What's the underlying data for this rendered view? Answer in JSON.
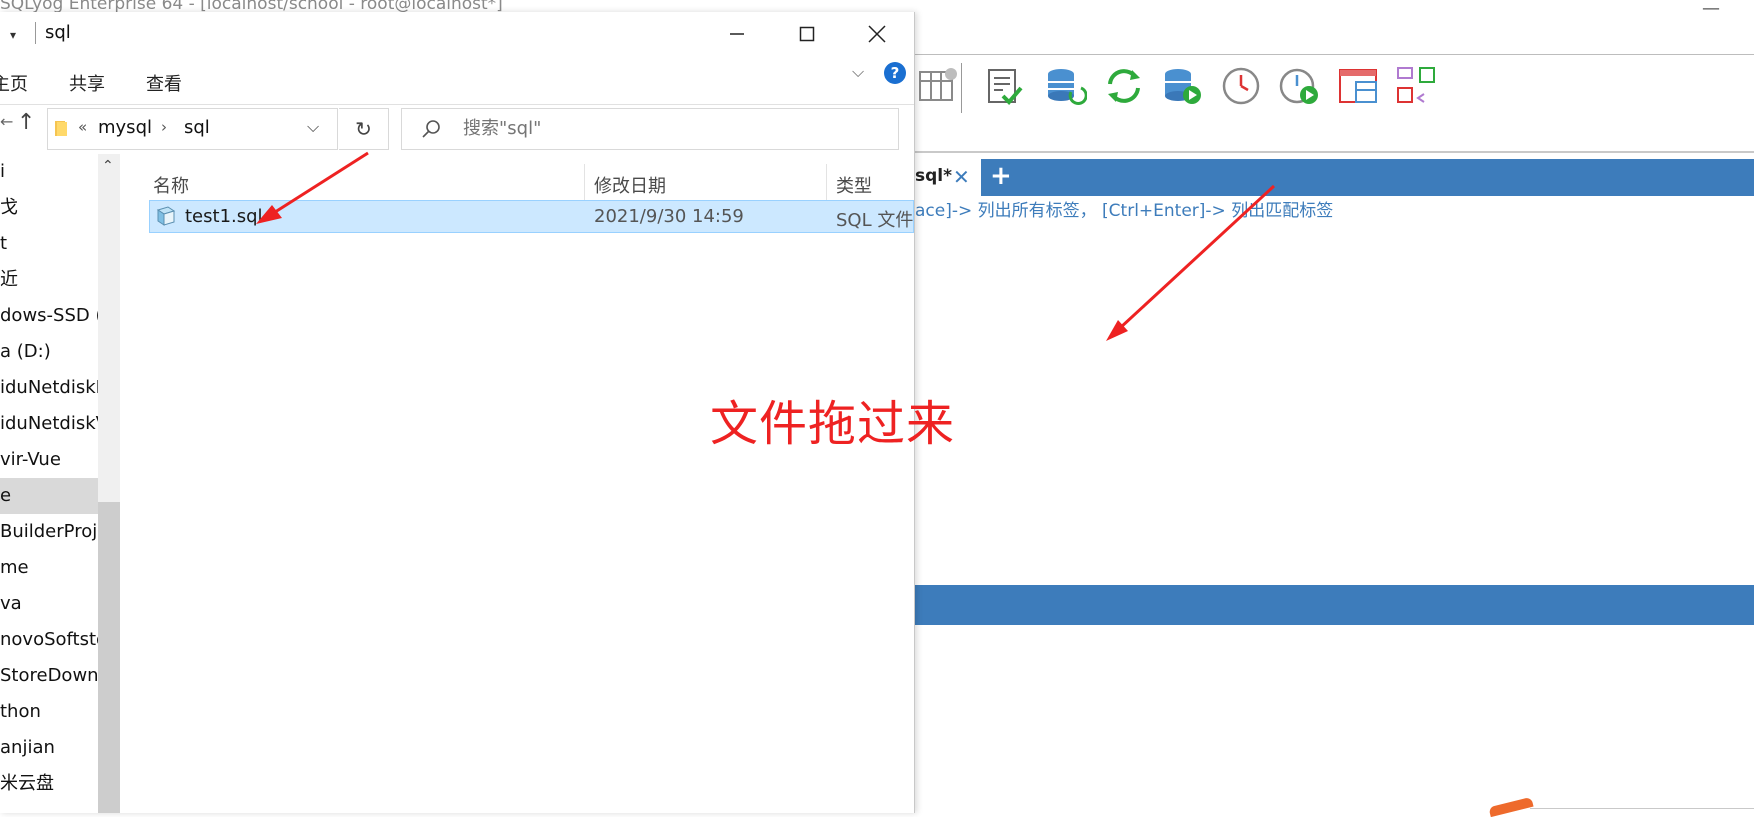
{
  "sqlyog": {
    "title": "SQLyog Enterprise 64 - [localhost/school - root@localhost*]",
    "minimize": "—",
    "tab_label": "sql*",
    "tab_close": "✕",
    "tab_add": "+",
    "hint": "ace]-> 列出所有标签， [Ctrl+Enter]-> 列出匹配标签",
    "toolbar_icons": [
      "table-icon",
      "check-query-icon",
      "db-sync-icon",
      "refresh-icon",
      "db-add-icon",
      "clock-icon",
      "schedule-icon",
      "layout-icon",
      "compare-icon"
    ],
    "accent": "#3d7cbb"
  },
  "explorer": {
    "title": "sql",
    "qa_arrow": "▾",
    "ribbon_tabs": [
      "主页",
      "共享",
      "查看"
    ],
    "help": "?",
    "collapse": "⌵",
    "nav_back": "←",
    "nav_up": "↑",
    "path": {
      "overflow": "«",
      "crumbs": [
        "mysql",
        "sql"
      ],
      "sep": "›"
    },
    "dropdown": "⌵",
    "refresh": "↻",
    "search_placeholder": "搜索\"sql\"",
    "nav_items": [
      "i",
      "戈",
      "t",
      "近",
      "dows-SSD (",
      "a (D:)",
      "iduNetdiskI",
      "iduNetdiskV",
      "vir-Vue",
      "e",
      "BuilderProje",
      "me",
      "va",
      "novoSoftsto",
      "StoreDownl",
      "thon",
      "anjian",
      "米云盘"
    ],
    "nav_selected_index": 9,
    "scroll_up": "⌃",
    "columns": [
      "名称",
      "修改日期",
      "类型"
    ],
    "files": [
      {
        "name": "test1.sql",
        "modified": "2021/9/30 14:59",
        "type": "SQL 文件"
      }
    ]
  },
  "annotation": {
    "text": "文件拖过来",
    "color": "#ee2222"
  }
}
